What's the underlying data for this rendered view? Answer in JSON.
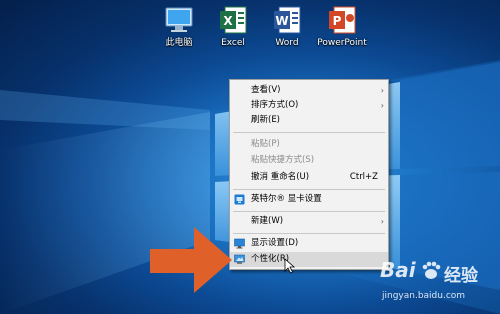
{
  "desktop": {
    "icons": [
      {
        "label": "此电脑",
        "icon": "computer-icon"
      },
      {
        "label": "Excel",
        "icon": "excel-icon"
      },
      {
        "label": "Word",
        "icon": "word-icon"
      },
      {
        "label": "PowerPoint",
        "icon": "powerpoint-icon"
      }
    ]
  },
  "context_menu": {
    "items": [
      {
        "label": "查看(V)",
        "submenu": true,
        "disabled": false
      },
      {
        "label": "排序方式(O)",
        "submenu": true,
        "disabled": false
      },
      {
        "label": "刷新(E)",
        "submenu": false,
        "disabled": false
      },
      {
        "label": "粘贴(P)",
        "submenu": false,
        "disabled": true
      },
      {
        "label": "粘贴快捷方式(S)",
        "submenu": false,
        "disabled": true
      },
      {
        "label": "撤消 重命名(U)",
        "shortcut": "Ctrl+Z",
        "submenu": false,
        "disabled": false
      },
      {
        "label": "英特尔® 显卡设置",
        "icon": "intel-graphics-icon",
        "submenu": false,
        "disabled": false
      },
      {
        "label": "新建(W)",
        "submenu": true,
        "disabled": false
      },
      {
        "label": "显示设置(D)",
        "icon": "display-icon",
        "submenu": false,
        "disabled": false
      },
      {
        "label": "个性化(R)",
        "icon": "personalize-icon",
        "submenu": false,
        "disabled": false,
        "highlighted": true
      }
    ],
    "submenu_glyph": "›"
  },
  "watermark": {
    "brand": "Bai",
    "brand_suffix": "经验",
    "url": "jingyan.baidu.com"
  },
  "colors": {
    "arrow": "#e0602a",
    "menu_bg": "#f2f2f2",
    "highlight": "#d9d9d9"
  }
}
